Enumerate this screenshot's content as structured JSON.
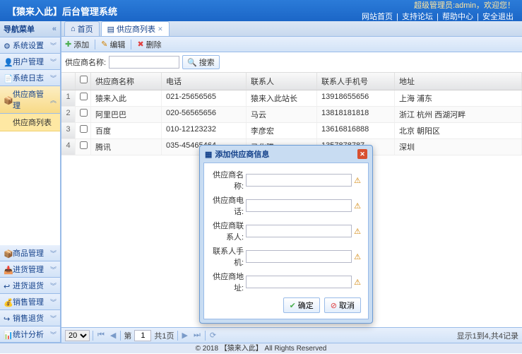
{
  "header": {
    "title": "【猿来入此】后台管理系统",
    "welcome_prefix": "超级管理员:",
    "welcome_user": "admin",
    "welcome_suffix": "，欢迎您！",
    "links": [
      "网站首页",
      "支持论坛",
      "帮助中心",
      "安全退出"
    ]
  },
  "sidebar": {
    "title": "导航菜单",
    "groups_top": [
      {
        "label": "系统设置"
      },
      {
        "label": "用户管理"
      },
      {
        "label": "系统日志"
      }
    ],
    "active_group": "供应商管理",
    "subitem": "供应商列表",
    "groups_bottom": [
      {
        "label": "商品管理"
      },
      {
        "label": "进货管理"
      },
      {
        "label": "进货退货"
      },
      {
        "label": "销售管理"
      },
      {
        "label": "销售退货"
      },
      {
        "label": "统计分析"
      }
    ]
  },
  "tabs": [
    {
      "label": "首页",
      "closable": false
    },
    {
      "label": "供应商列表",
      "closable": true,
      "active": true
    }
  ],
  "toolbar": {
    "add": "添加",
    "edit": "编辑",
    "del": "删除"
  },
  "search": {
    "label": "供应商名称:",
    "button": "搜索",
    "value": ""
  },
  "columns": {
    "name": "供应商名称",
    "phone": "电话",
    "contact": "联系人",
    "mobile": "联系人手机号",
    "addr": "地址"
  },
  "rows": [
    {
      "n": "1",
      "name": "猿来入此",
      "phone": "021-25656565",
      "contact": "猿来入此站长",
      "mobile": "13918655656",
      "addr": "上海 浦东"
    },
    {
      "n": "2",
      "name": "阿里巴巴",
      "phone": "020-56565656",
      "contact": "马云",
      "mobile": "13818181818",
      "addr": "浙江 杭州 西湖河畔"
    },
    {
      "n": "3",
      "name": "百度",
      "phone": "010-12123232",
      "contact": "李彦宏",
      "mobile": "13616816888",
      "addr": "北京 朝阳区"
    },
    {
      "n": "4",
      "name": "腾讯",
      "phone": "035-45465464",
      "contact": "马化腾",
      "mobile": "1357878787",
      "addr": "深圳"
    }
  ],
  "pager": {
    "page_size": "20",
    "page": "1",
    "page_label_prefix": "第",
    "page_label_suffix": "共1页",
    "info": "显示1到4,共4记录"
  },
  "dialog": {
    "title": "添加供应商信息",
    "fields": {
      "name": "供应商名称:",
      "phone": "供应商电话:",
      "contact": "供应商联系人:",
      "mobile": "联系人手机:",
      "addr": "供应商地址:"
    },
    "ok": "确定",
    "cancel": "取消"
  },
  "footer": "© 2018 【猿来入此】 All Rights Reserved"
}
